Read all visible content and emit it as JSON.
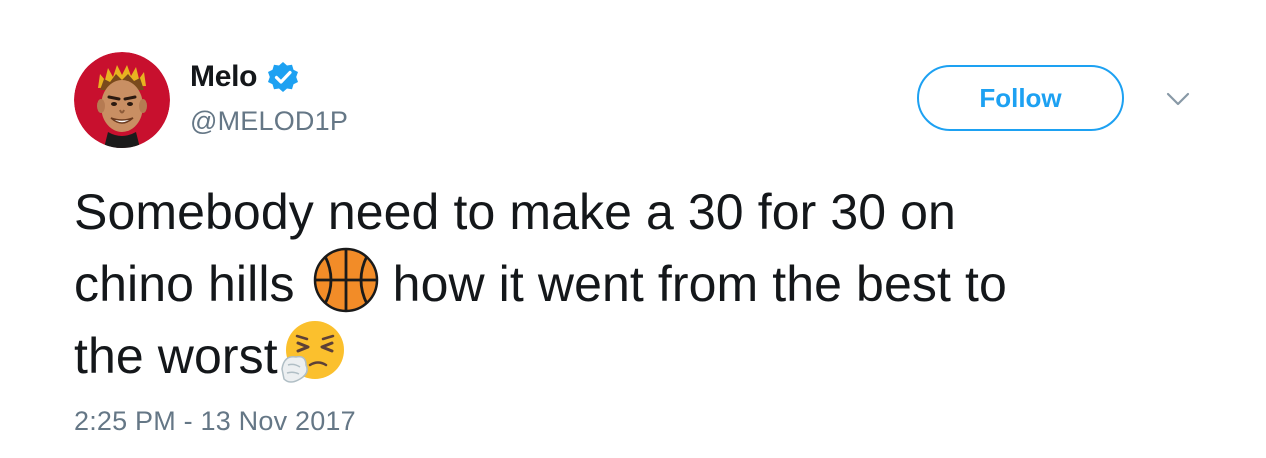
{
  "user": {
    "display_name": "Melo",
    "handle": "@MELOD1P",
    "verified": true,
    "avatar_icon": "cartoon-portrait-avatar"
  },
  "actions": {
    "follow_label": "Follow",
    "menu_icon": "chevron-down-icon"
  },
  "tweet": {
    "text_line1": "Somebody need to make a 30 for 30 on",
    "text_line2a": "chino hills",
    "emoji1": "basketball-emoji",
    "text_line2b": "how it went from the best to",
    "text_line3": "the worst",
    "emoji2": "sneezing-face-emoji",
    "timestamp": "2:25 PM - 13 Nov 2017"
  },
  "colors": {
    "brand_blue": "#1da1f2",
    "text_primary": "#14171a",
    "text_secondary": "#657786"
  }
}
